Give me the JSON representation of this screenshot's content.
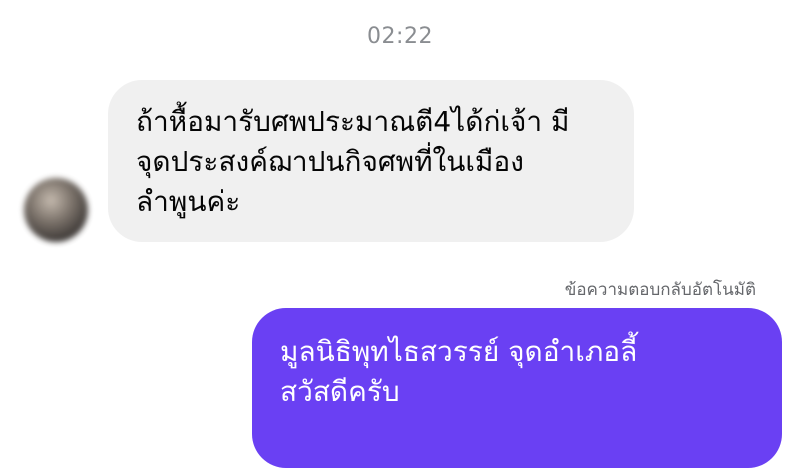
{
  "chat": {
    "timestamp": "02:22",
    "incoming": {
      "lines": [
        "ถ้าหื้อมารับศพประมาณตี4ได้ก่เจ้า มี",
        "จุดประสงค์ฌาปนกิจศพที่ในเมือง",
        "ลำพูนค่ะ"
      ]
    },
    "auto_reply_label": "ข้อความตอบกลับอัตโนมัติ",
    "outgoing": {
      "lines": [
        "มูลนิธิพุทไธสวรรย์ จุดอำเภอลี้",
        "สวัสดีครับ"
      ]
    },
    "colors": {
      "incoming_bubble": "#f0f0f0",
      "outgoing_bubble": "#6a40f3",
      "timestamp": "#8a8d91"
    }
  }
}
